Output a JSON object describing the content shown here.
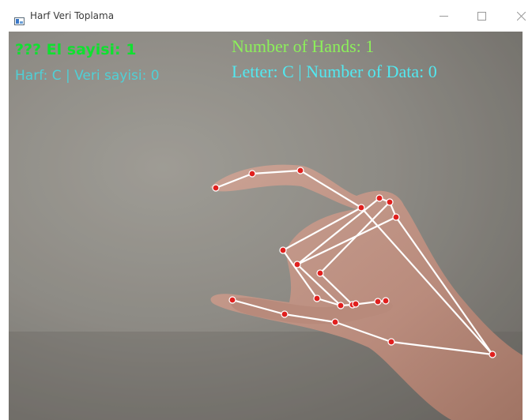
{
  "window": {
    "title": "Harf Veri Toplama",
    "icon": "app-window-icon",
    "controls": [
      "minimize-icon",
      "maximize-icon",
      "close-icon"
    ]
  },
  "overlay": {
    "hands_line_tr": "??? El sayisi: 1",
    "letter_line_tr": "Harf: C | Veri sayisi: 0",
    "hands_line_en": "Number of Hands: 1",
    "letter_line_en": "Letter: C | Number of Data: 0"
  },
  "colors": {
    "text_green": "#10e030",
    "text_cyan": "#4fd0d6",
    "text_green_light": "#8cf05a",
    "text_cyan_light": "#52e8f0",
    "landmark": "#e0201e",
    "connection": "#ffffff"
  }
}
